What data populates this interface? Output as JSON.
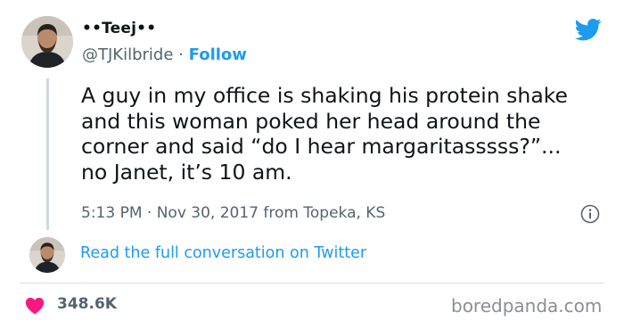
{
  "tweet": {
    "display_name": "••Teej••",
    "handle": "@TJKilbride",
    "separator": "·",
    "follow_label": "Follow",
    "text": "A guy in my office is shaking his protein shake and this woman poked her head around the corner and said “do I hear margaritasssss?”... no Janet, it’s 10 am.",
    "time": "5:13 PM",
    "meta_separator": "·",
    "date": "Nov 30, 2017",
    "location": "from Topeka, KS",
    "read_link": "Read the full conversation on Twitter",
    "like_count": "348.6K"
  },
  "icons": {
    "brand": "twitter-bird-icon",
    "info": "info-icon",
    "like": "heart-icon"
  },
  "watermark": "boredpanda.com",
  "colors": {
    "brand_blue": "#1d9bf0",
    "heart_pink": "#f91880",
    "secondary_text": "#536471",
    "thread_line": "#cfd9de"
  }
}
